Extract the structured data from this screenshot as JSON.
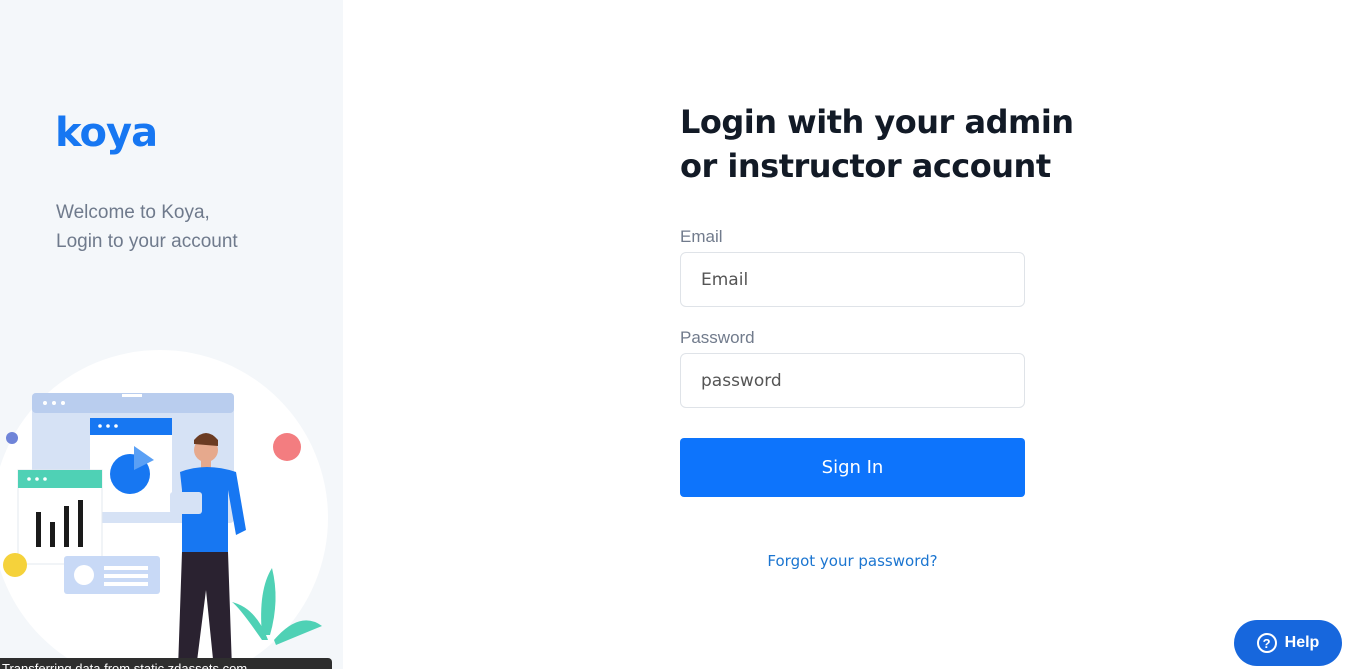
{
  "brand": {
    "logo_text": "koya",
    "accent": "#0d74fc"
  },
  "sidebar": {
    "welcome_line1": "Welcome to Koya,",
    "welcome_line2": "Login to your account"
  },
  "login": {
    "title_line1": "Login with your admin",
    "title_line2": "or instructor account",
    "email_label": "Email",
    "email_placeholder": "Email",
    "password_label": "Password",
    "password_placeholder": "password",
    "signin_label": "Sign In",
    "forgot_label": "Forgot your password?"
  },
  "help": {
    "label": "Help",
    "icon": "question-icon"
  },
  "status_bar": {
    "text": "Transferring data from static.zdassets.com..."
  }
}
